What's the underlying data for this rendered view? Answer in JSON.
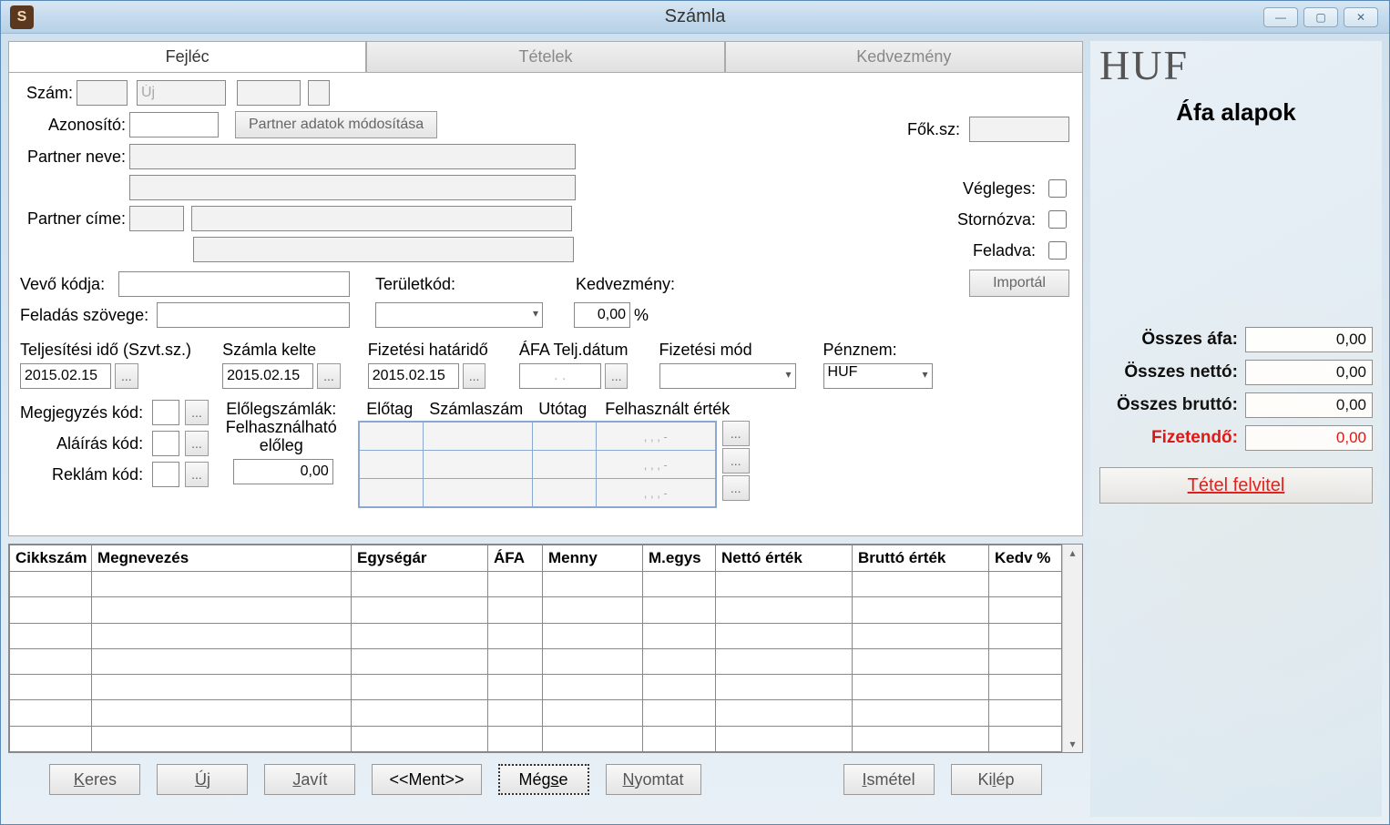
{
  "window": {
    "title": "Számla"
  },
  "tabs": {
    "t0": "Fejléc",
    "t1": "Tételek",
    "t2": "Kedvezmény"
  },
  "labels": {
    "szam": "Szám:",
    "uj": "Új",
    "azonosito": "Azonosító:",
    "partner_modosit": "Partner adatok módosítása",
    "partner_neve": "Partner neve:",
    "partner_cime": "Partner címe:",
    "foksz": "Fők.sz:",
    "vegleges": "Végleges:",
    "stornozva": "Stornózva:",
    "feladva": "Feladva:",
    "importal": "Importál",
    "vevo_kodja": "Vevő kódja:",
    "teruletkod": "Területkód:",
    "kedvezmeny": "Kedvezmény:",
    "kedv_val": "0,00",
    "percent": "%",
    "telj_ido": "Teljesítési idő (Szvt.sz.)",
    "szamla_kelte": "Számla kelte",
    "fiz_hatarido": "Fizetési határidő",
    "afa_telj": "ÁFA Telj.dátum",
    "fiz_mod": "Fizetési mód",
    "penznem": "Pénznem:",
    "penznem_val": "HUF",
    "feladas_szovege": "Feladás szövege:",
    "megjegyzes_kod": "Megjegyzés kód:",
    "alairas_kod": "Aláírás kód:",
    "reklam_kod": "Reklám kód:",
    "eloleg_szamlak": "Előlegszámlák:",
    "felhasznalhato": "Felhasználható előleg",
    "eloleg_val": "0,00",
    "elotag": "Előtag",
    "szamlaszam": "Számlaszám",
    "utotag": "Utótag",
    "felhasznalt": "Felhasznált érték",
    "adv_dots": ", , , -",
    "ellipsis": "...",
    "date1": "2015.02.15",
    "date2": "2015.02.15",
    "date3": "2015.02.15",
    "date4": ". ."
  },
  "table": {
    "h0": "Cikkszám",
    "h1": "Megnevezés",
    "h2": "Egységár",
    "h3": "ÁFA",
    "h4": "Menny",
    "h5": "M.egys",
    "h6": "Nettó érték",
    "h7": "Bruttó érték",
    "h8": "Kedv %"
  },
  "footer": {
    "keres": "Keres",
    "uj": "Új",
    "javit": "Javít",
    "ment": "<<Ment>>",
    "megse": "Mégse",
    "nyomtat": "Nyomtat",
    "ismetel": "Ismétel",
    "kilep": "Kilép"
  },
  "side": {
    "huf": "HUF",
    "title": "Áfa alapok",
    "osszes_afa": "Összes áfa:",
    "osszes_netto": "Összes nettó:",
    "osszes_brutto": "Összes bruttó:",
    "fizetendo": "Fizetendő:",
    "v0": "0,00",
    "v1": "0,00",
    "v2": "0,00",
    "v3": "0,00",
    "tetel": "Tétel felvitel"
  }
}
